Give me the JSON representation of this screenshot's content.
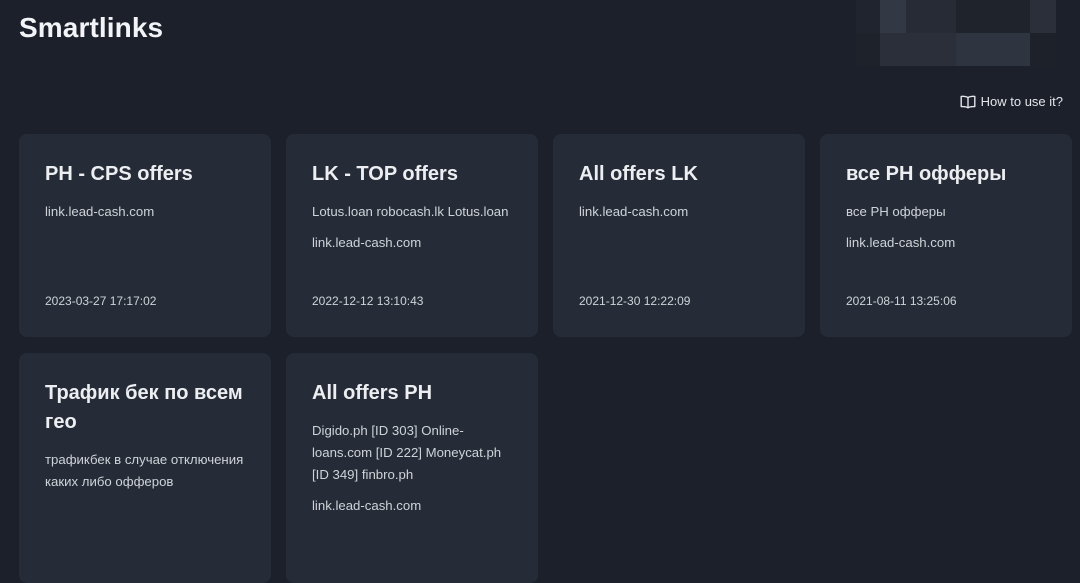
{
  "page": {
    "title": "Smartlinks",
    "help_link": "How to use it?"
  },
  "cards": [
    {
      "title": "PH - CPS offers",
      "description": "",
      "link": "link.lead-cash.com",
      "date": "2023-03-27 17:17:02"
    },
    {
      "title": "LK - TOP offers",
      "description": "Lotus.loan robocash.lk Lotus.loan",
      "link": "link.lead-cash.com",
      "date": "2022-12-12 13:10:43"
    },
    {
      "title": "All offers LK",
      "description": "",
      "link": "link.lead-cash.com",
      "date": "2021-12-30 12:22:09"
    },
    {
      "title": "все PH офферы",
      "description": "все PH офферы",
      "link": "link.lead-cash.com",
      "date": "2021-08-11 13:25:06"
    },
    {
      "title": "Трафик бек по всем гео",
      "description": "трафикбек в случае отключения каких либо офферов",
      "link": "",
      "date": ""
    },
    {
      "title": "All offers PH",
      "description": "Digido.ph [ID 303] Online-loans.com [ID 222] Moneycat.ph [ID 349] finbro.ph",
      "link": "link.lead-cash.com",
      "date": ""
    }
  ],
  "colors": {
    "background": "#1b202a",
    "card": "#262c37",
    "text": "#e6e8ec"
  },
  "icons": {
    "help": "book-open-icon"
  }
}
